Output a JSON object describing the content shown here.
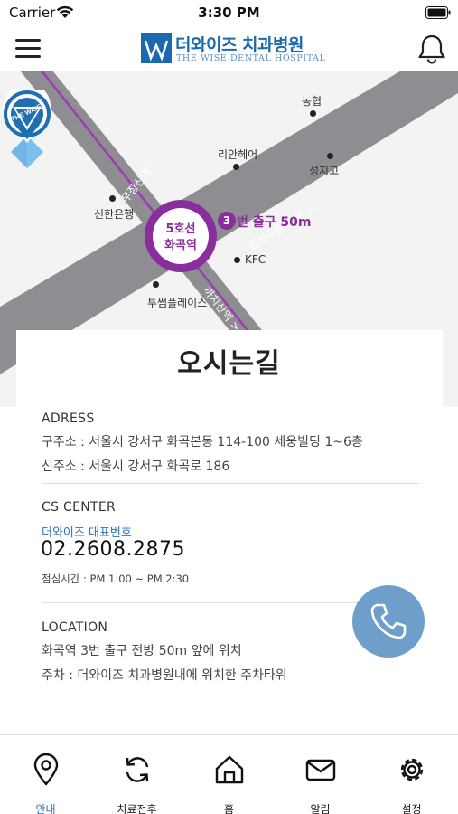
{
  "status_bar": {
    "carrier": "Carrier",
    "time": "3:30 PM"
  },
  "header": {
    "logo_title": "더와이즈 치과병원",
    "logo_subtitle": "THE WISE DENTAL HOSPITAL",
    "logo_mark_text": "THE WISE"
  },
  "map": {
    "poi": {
      "nonghyup": "농협",
      "lian_hair": "리안헤어",
      "shinhan": "신한은행",
      "kfc": "KFC",
      "two_some": "투썸플레이스",
      "seongji": "성지고"
    },
    "roads": {
      "ujangsan": "< 우장산역",
      "gangseo_office": "강서구청 방면 >",
      "kkachisan": "까치산역 >"
    },
    "station": {
      "line": "5호선",
      "name": "화곡역"
    },
    "exit": {
      "number": "3",
      "label": "번 출구 50m"
    },
    "pin_text": "THE WISE"
  },
  "title": "오시는길",
  "address": {
    "heading": "ADRESS",
    "old": "구주소 : 서울시 강서구 화곡본동 114-100 세웅빌딩 1~6층",
    "new": "신주소 : 서울시 강서구 화곡로 186"
  },
  "cs_center": {
    "heading": "CS CENTER",
    "rep_label": "더와이즈 대표번호",
    "phone": "02.2608.2875",
    "hours": "점심시간 : PM 1:00 ~ PM 2:30"
  },
  "location": {
    "heading": "LOCATION",
    "line1": "화곡역 3번 출구 전방 50m 앞에 위치",
    "line2": "주차 : 더와이즈 치과병원내에 위치한 주차타워"
  },
  "tabs": [
    {
      "label": "안내",
      "icon": "location-pin-icon",
      "active": true
    },
    {
      "label": "치료전후",
      "icon": "refresh-icon",
      "active": false
    },
    {
      "label": "홈",
      "icon": "home-icon",
      "active": false
    },
    {
      "label": "알림",
      "icon": "mail-icon",
      "active": false
    },
    {
      "label": "설정",
      "icon": "gear-icon",
      "active": false
    }
  ],
  "colors": {
    "accent_blue": "#2a72b5",
    "subway_purple": "#8a2d9d",
    "road_gray": "#8e8e92",
    "call_button": "#6e9fcb",
    "pin_blue": "#1f6fb3"
  }
}
